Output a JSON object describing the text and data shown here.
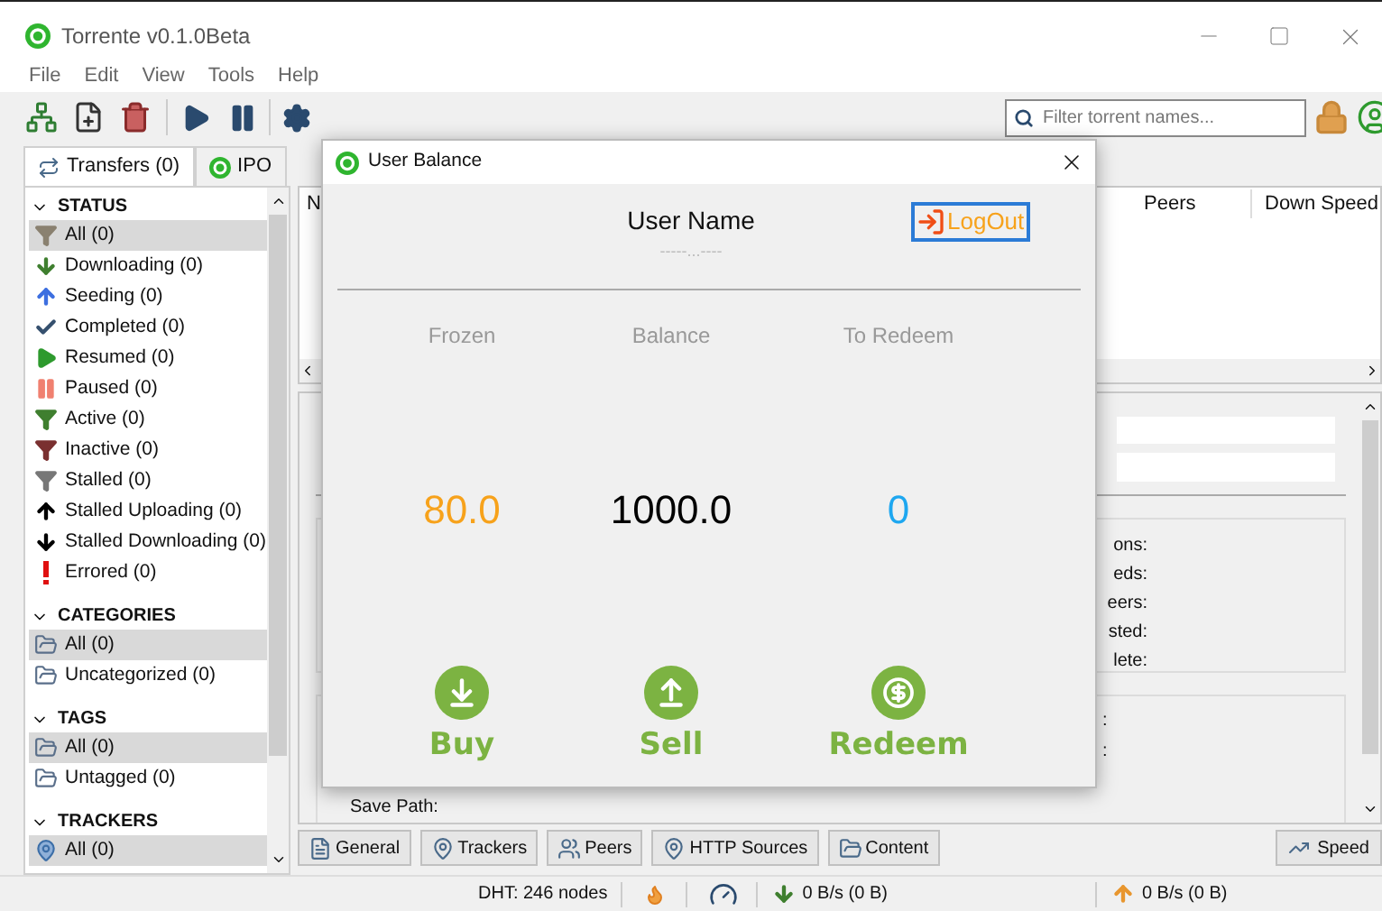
{
  "window": {
    "title": "Torrente v0.1.0Beta"
  },
  "menu": [
    "File",
    "Edit",
    "View",
    "Tools",
    "Help"
  ],
  "toolbar": {
    "search": {
      "placeholder": "Filter torrent names..."
    }
  },
  "side_tabs": [
    {
      "label": "Transfers (0)",
      "selected": true,
      "kind": "transfers"
    },
    {
      "label": "IPO",
      "selected": false,
      "kind": "ipo"
    }
  ],
  "sidebar": {
    "sections": [
      {
        "title": "STATUS",
        "expanded": true,
        "items": [
          {
            "label": "All (0)",
            "selected": true,
            "kind": "all"
          },
          {
            "label": "Downloading (0)",
            "selected": false,
            "kind": "downloading"
          },
          {
            "label": "Seeding (0)",
            "selected": false,
            "kind": "seeding"
          },
          {
            "label": "Completed (0)",
            "selected": false,
            "kind": "completed"
          },
          {
            "label": "Resumed (0)",
            "selected": false,
            "kind": "resumed"
          },
          {
            "label": "Paused (0)",
            "selected": false,
            "kind": "paused"
          },
          {
            "label": "Active (0)",
            "selected": false,
            "kind": "active"
          },
          {
            "label": "Inactive (0)",
            "selected": false,
            "kind": "inactive"
          },
          {
            "label": "Stalled (0)",
            "selected": false,
            "kind": "stalled"
          },
          {
            "label": "Stalled Uploading (0)",
            "selected": false,
            "kind": "stalled_up"
          },
          {
            "label": "Stalled Downloading (0)",
            "selected": false,
            "kind": "stalled_down"
          },
          {
            "label": "Errored (0)",
            "selected": false,
            "kind": "errored"
          }
        ]
      },
      {
        "title": "CATEGORIES",
        "expanded": true,
        "items": [
          {
            "label": "All (0)",
            "selected": true,
            "kind": "folder"
          },
          {
            "label": "Uncategorized (0)",
            "selected": false,
            "kind": "folder"
          }
        ]
      },
      {
        "title": "TAGS",
        "expanded": true,
        "items": [
          {
            "label": "All (0)",
            "selected": true,
            "kind": "folder"
          },
          {
            "label": "Untagged (0)",
            "selected": false,
            "kind": "folder"
          }
        ]
      },
      {
        "title": "TRACKERS",
        "expanded": true,
        "items": [
          {
            "label": "All (0)",
            "selected": true,
            "kind": "tracker"
          }
        ]
      }
    ]
  },
  "torrent_table": {
    "columns": [
      "N",
      "Peers",
      "Down Speed"
    ]
  },
  "details": {
    "group_1_labels": [
      "ons:",
      "eds:",
      "eers:",
      "sted:",
      "lete:"
    ],
    "group_2_labels": [
      ":",
      ":"
    ],
    "save_path_label": "Save Path:"
  },
  "detail_tabs": [
    {
      "label": "General",
      "kind": "general"
    },
    {
      "label": "Trackers",
      "kind": "trackers"
    },
    {
      "label": "Peers",
      "kind": "peers"
    },
    {
      "label": "HTTP Sources",
      "kind": "http"
    },
    {
      "label": "Content",
      "kind": "content"
    }
  ],
  "speed_button": "Speed",
  "status_bar": {
    "dht": "DHT: 246 nodes",
    "download": "0 B/s (0 B)",
    "upload": "0 B/s (0 B)"
  },
  "dialog": {
    "title": "User Balance",
    "user_name": "User Name",
    "user_id": "-----...----",
    "logout": "LogOut",
    "stats": [
      {
        "label": "Frozen",
        "value": "80.0",
        "color": "#f7a21b"
      },
      {
        "label": "Balance",
        "value": "1000.0",
        "color": "#000000"
      },
      {
        "label": "To Redeem",
        "value": "0",
        "color": "#1ea7f0"
      }
    ],
    "actions": [
      {
        "label": "Buy",
        "kind": "buy"
      },
      {
        "label": "Sell",
        "kind": "sell"
      },
      {
        "label": "Redeem",
        "kind": "redeem"
      }
    ]
  }
}
